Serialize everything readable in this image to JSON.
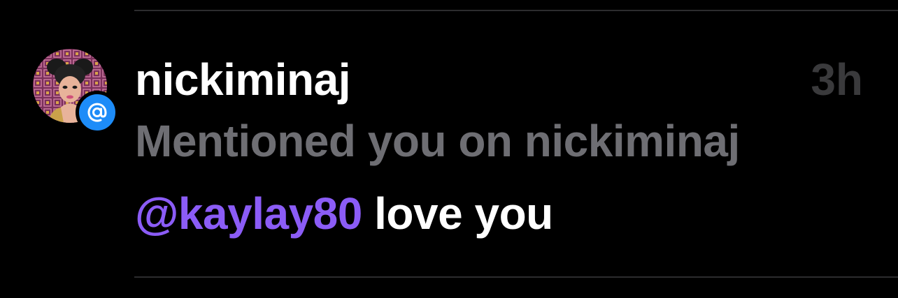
{
  "notification": {
    "username": "nickiminaj",
    "timestamp": "3h",
    "subtitle": "Mentioned you on nickiminaj",
    "mention": "@kaylay80",
    "message_text": " love you",
    "badge_icon": "at-sign-icon",
    "colors": {
      "background": "#000000",
      "username": "#ffffff",
      "timestamp": "#3a3a3c",
      "subtitle": "#6e6e73",
      "mention": "#8b5cf6",
      "badge": "#1d8cf8",
      "divider": "#2c2c2e"
    }
  }
}
